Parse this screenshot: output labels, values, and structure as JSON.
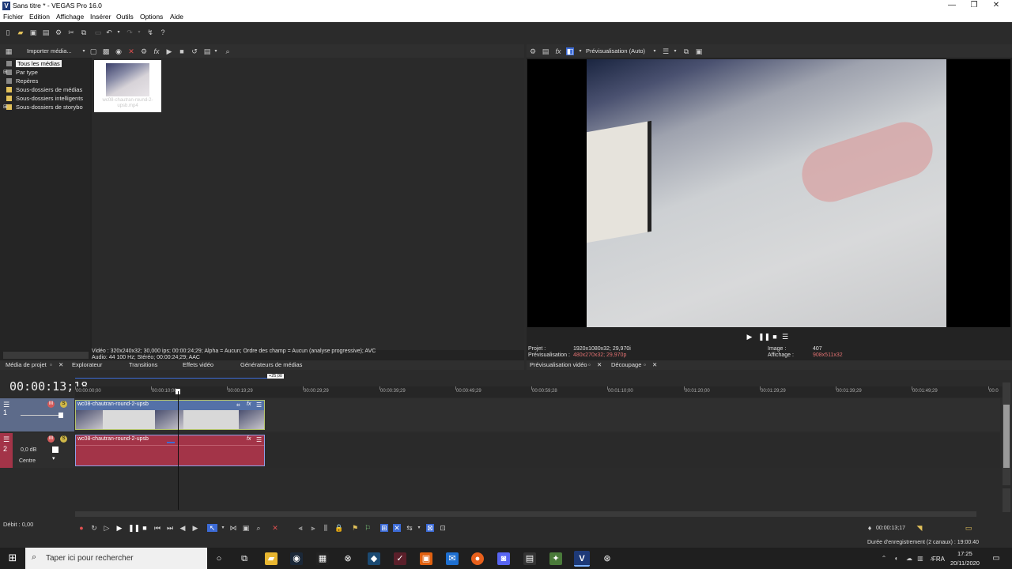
{
  "window": {
    "title": "Sans titre * - VEGAS Pro 16.0",
    "logo_letter": "V",
    "minimize": "—",
    "maximize": "❐",
    "close": "✕"
  },
  "menu": [
    "Fichier",
    "Edition",
    "Affichage",
    "Insérer",
    "Outils",
    "Options",
    "Aide"
  ],
  "explorer": {
    "import_label": "Importer média...",
    "tree": [
      "Tous les médias",
      "Par type",
      "Repères",
      "Sous-dossiers de médias",
      "Sous-dossiers intelligents",
      "Sous-dossiers de storybo"
    ],
    "media_item_label": "wc08-chautran-round-2-upsb.mp4",
    "info_line1": "Vidéo : 320x240x32; 30,000 ips; 00:00:24;29; Alpha = Aucun; Ordre des champ = Aucun (analyse progressive); AVC",
    "info_line2": "Audio: 44 100 Hz; Stéréo; 00:00:24;29; AAC",
    "tabs": [
      "Média de projet",
      "Explorateur",
      "Transitions",
      "Effets vidéo",
      "Générateurs de médias"
    ]
  },
  "preview": {
    "mode_label": "Prévisualisation (Auto)",
    "project_label": "Projet :",
    "project_value": "1920x1080x32; 29,970i",
    "preview_label": "Prévisualisation :",
    "preview_value": "480x270x32; 29,970p",
    "image_label": "Image :",
    "image_value": "407",
    "display_label": "Affichage :",
    "display_value": "908x511x32",
    "tabs": [
      "Prévisualisation vidéo",
      "Découpage"
    ]
  },
  "timeline": {
    "time": "00:00:13;18",
    "marker": "+25;00",
    "ruler": [
      "00:00:00;00",
      "00:00:10;00",
      "00:00:19;29",
      "00:00:29;29",
      "00:00:39;29",
      "00:00:49;29",
      "00:00:59;28",
      "00:01:10;00",
      "00:01:20;00",
      "00:01:29;29",
      "00:01:39;29",
      "00:01:49;29",
      "00:0"
    ],
    "video_clip": "wc08-chautran-round-2-upsb",
    "audio_clip": "wc08-chautran-round-2-upsb",
    "track1_number": "1",
    "track2_number": "2",
    "audio_level": "0,0 dB",
    "audio_pan": "Centre",
    "rate": "Débit : 0,00",
    "end_time": "00:00:13;17"
  },
  "status": {
    "recording": "Durée d'enregistrement (2 canaux) : 19:00:40"
  },
  "taskbar": {
    "search_placeholder": "Taper ici pour rechercher",
    "lang": "FRA",
    "time": "17:25",
    "date": "20/11/2020"
  },
  "colors": {
    "video_clip": "#5471a8",
    "audio_clip": "#a33448",
    "video_head": "#5d6b8a",
    "accent": "#3c6bd6"
  }
}
